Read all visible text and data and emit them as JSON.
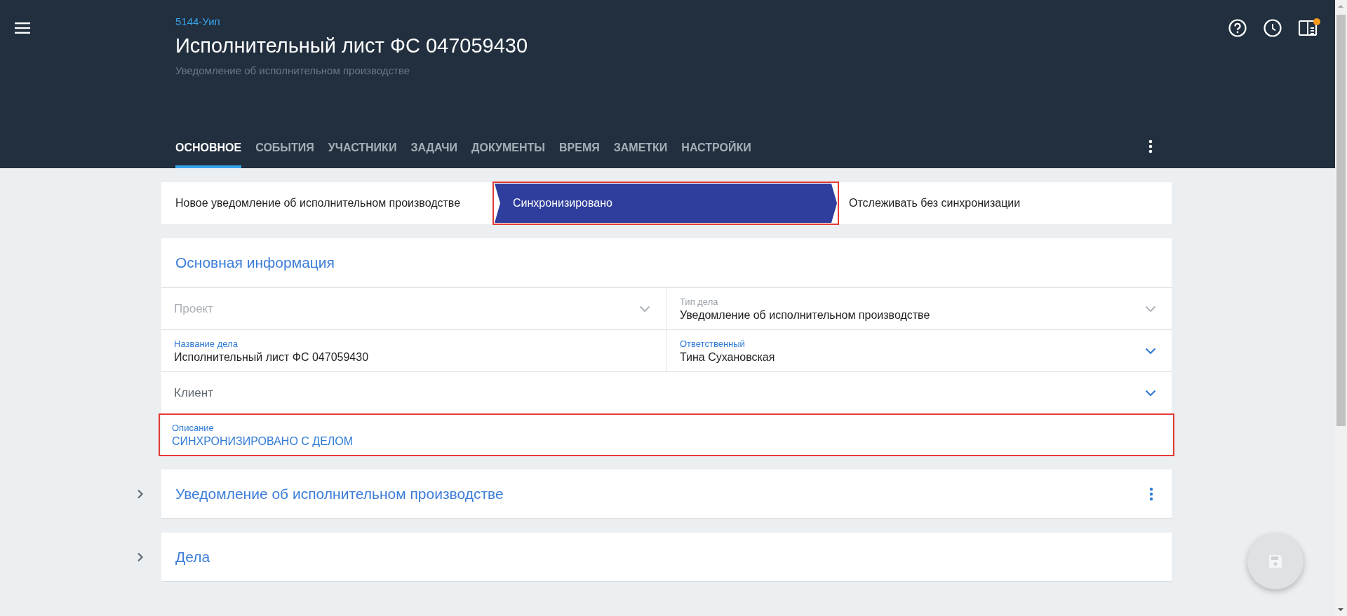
{
  "header": {
    "case_code": "5144-Уип",
    "title": "Исполнительный лист ФС 047059430",
    "subtitle": "Уведомление об исполнительном производстве",
    "notification_badge": true
  },
  "tabs": [
    {
      "label": "ОСНОВНОЕ",
      "selected": true
    },
    {
      "label": "СОБЫТИЯ",
      "selected": false
    },
    {
      "label": "УЧАСТНИКИ",
      "selected": false
    },
    {
      "label": "ЗАДАЧИ",
      "selected": false
    },
    {
      "label": "ДОКУМЕНТЫ",
      "selected": false
    },
    {
      "label": "ВРЕМЯ",
      "selected": false
    },
    {
      "label": "ЗАМЕТКИ",
      "selected": false
    },
    {
      "label": "НАСТРОЙКИ",
      "selected": false
    }
  ],
  "stages": [
    {
      "label": "Новое уведомление об исполнительном производстве",
      "selected": false,
      "highlighted": false
    },
    {
      "label": "Синхронизировано",
      "selected": true,
      "highlighted": true
    },
    {
      "label": "Отслеживать без синхронизации",
      "selected": false,
      "highlighted": false
    }
  ],
  "main_info": {
    "title": "Основная информация",
    "rows": [
      [
        {
          "kind": "select",
          "placeholder": "Проект",
          "disabled": true
        },
        {
          "kind": "select",
          "label": "Тип дела",
          "value": "Уведомление об исполнительном производстве",
          "disabled": true
        }
      ],
      [
        {
          "kind": "text",
          "label": "Название дела",
          "value": "Исполнительный лист ФС 047059430",
          "disabled": false
        },
        {
          "kind": "select",
          "label": "Ответственный",
          "value": "Тина Сухановская",
          "disabled": false
        }
      ],
      [
        {
          "kind": "select",
          "placeholder": "Клиент",
          "disabled": false
        }
      ],
      [
        {
          "kind": "link",
          "label": "Описание",
          "value": "СИНХРОНИЗИРОВАНО С ДЕЛОМ",
          "disabled": false,
          "highlighted": true
        }
      ]
    ]
  },
  "sections": [
    {
      "title": "Уведомление об исполнительном производстве",
      "expanded": false,
      "has_menu": true
    },
    {
      "title": "Дела",
      "expanded": false,
      "has_menu": false
    }
  ],
  "save_button": {
    "disabled": true
  }
}
